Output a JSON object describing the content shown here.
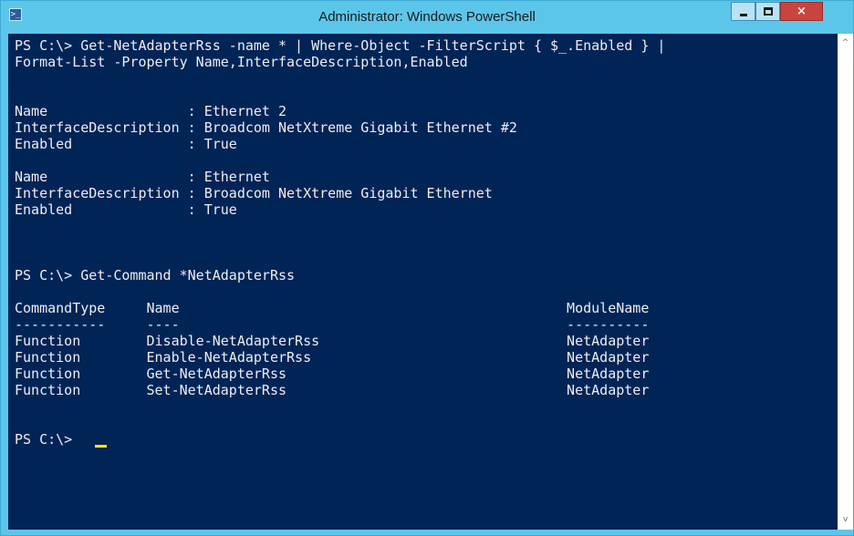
{
  "window": {
    "title": "Administrator: Windows PowerShell",
    "icon": "powershell-icon",
    "controls": {
      "minimize": "minimize-icon",
      "maximize": "maximize-icon",
      "close": "×"
    }
  },
  "console": {
    "background_color": "#012456",
    "text_color": "#eeedf0",
    "cursor_color": "#f5e800",
    "lines": [
      "PS C:\\> Get-NetAdapterRss -name * | Where-Object -FilterScript { $_.Enabled } |",
      "Format-List -Property Name,InterfaceDescription,Enabled",
      "",
      "",
      "Name                 : Ethernet 2",
      "InterfaceDescription : Broadcom NetXtreme Gigabit Ethernet #2",
      "Enabled              : True",
      "",
      "Name                 : Ethernet",
      "InterfaceDescription : Broadcom NetXtreme Gigabit Ethernet",
      "Enabled              : True",
      "",
      "",
      "",
      "PS C:\\> Get-Command *NetAdapterRss",
      "",
      "CommandType     Name                                               ModuleName",
      "-----------     ----                                               ----------",
      "Function        Disable-NetAdapterRss                              NetAdapter",
      "Function        Enable-NetAdapterRss                               NetAdapter",
      "Function        Get-NetAdapterRss                                  NetAdapter",
      "Function        Set-NetAdapterRss                                  NetAdapter",
      "",
      "",
      "PS C:\\> "
    ]
  },
  "scrollbar": {
    "up": "^",
    "down": "v"
  }
}
